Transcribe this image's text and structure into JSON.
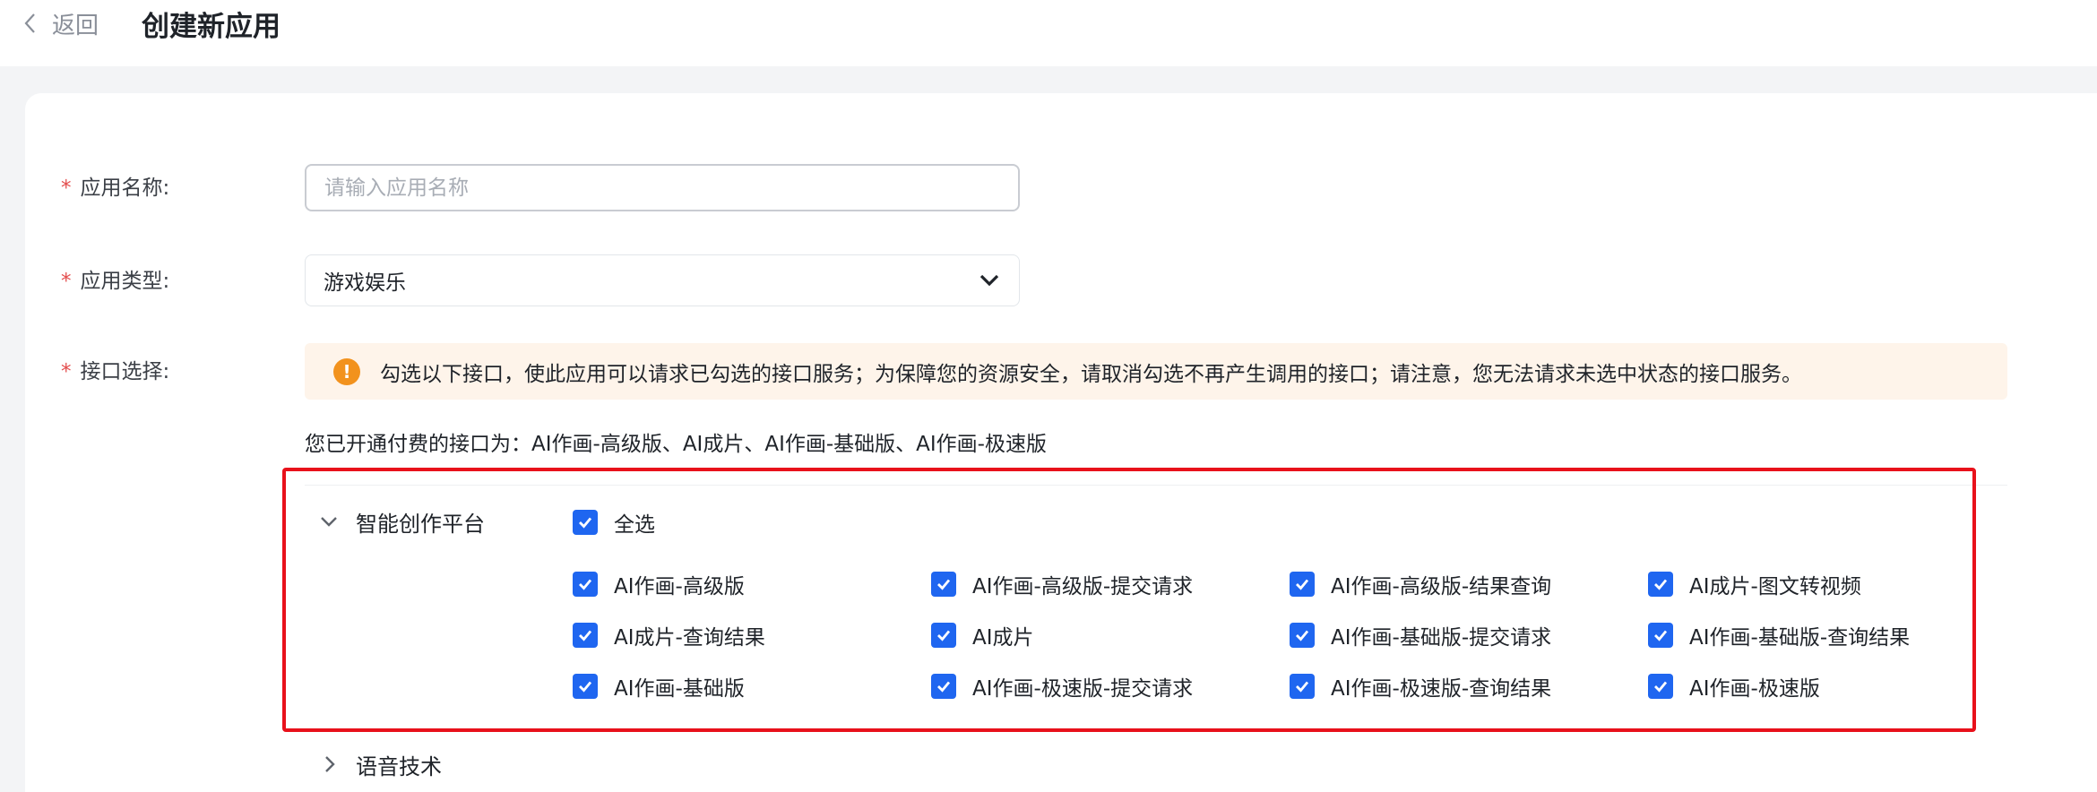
{
  "header": {
    "back_label": "返回",
    "title": "创建新应用"
  },
  "form": {
    "required_mark": "*",
    "app_name": {
      "label": "应用名称:",
      "value": "",
      "placeholder": "请输入应用名称"
    },
    "app_type": {
      "label": "应用类型:",
      "value": "游戏娱乐"
    },
    "api_select": {
      "label": "接口选择:",
      "notice_icon": "!",
      "notice": "勾选以下接口，使此应用可以请求已勾选的接口服务；为保障您的资源安全，请取消勾选不再产生调用的接口；请注意，您无法请求未选中状态的接口服务。",
      "paid_text": "您已开通付费的接口为：AI作画-高级版、AI成片、AI作画-基础版、AI作画-极速版"
    }
  },
  "groups": [
    {
      "name": "智能创作平台",
      "expanded": true,
      "select_all": {
        "label": "全选",
        "checked": true
      },
      "items": [
        {
          "label": "AI作画-高级版",
          "checked": true
        },
        {
          "label": "AI作画-高级版-提交请求",
          "checked": true
        },
        {
          "label": "AI作画-高级版-结果查询",
          "checked": true
        },
        {
          "label": "AI成片-图文转视频",
          "checked": true
        },
        {
          "label": "AI成片-查询结果",
          "checked": true
        },
        {
          "label": "AI成片",
          "checked": true
        },
        {
          "label": "AI作画-基础版-提交请求",
          "checked": true
        },
        {
          "label": "AI作画-基础版-查询结果",
          "checked": true
        },
        {
          "label": "AI作画-基础版",
          "checked": true
        },
        {
          "label": "AI作画-极速版-提交请求",
          "checked": true
        },
        {
          "label": "AI作画-极速版-查询结果",
          "checked": true
        },
        {
          "label": "AI作画-极速版",
          "checked": true
        }
      ]
    },
    {
      "name": "语音技术",
      "expanded": false
    }
  ],
  "colors": {
    "accent": "#1f66f0",
    "required": "#e34d4d",
    "warning": "#f2921d",
    "notice_bg": "#fef4ea",
    "highlight_border": "#e8111b"
  },
  "icons": {
    "back": "chevron-left-icon",
    "dropdown": "chevron-down-icon",
    "warning": "warning-icon",
    "expanded": "chevron-down-icon",
    "collapsed": "chevron-right-icon",
    "checkbox": "checkmark-icon"
  }
}
